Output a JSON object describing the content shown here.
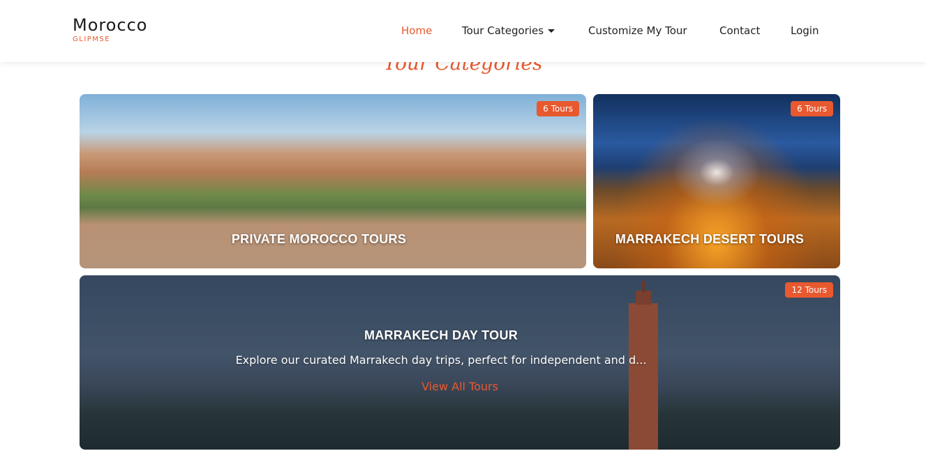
{
  "brand": {
    "name": "Morocco",
    "sub": "GLIPMSE"
  },
  "nav": {
    "items": [
      {
        "label": "Home",
        "active": true
      },
      {
        "label": "Tour Categories",
        "dropdown": true
      },
      {
        "label": "Customize My Tour"
      },
      {
        "label": "Contact"
      },
      {
        "label": "Login"
      }
    ]
  },
  "section": {
    "title": "Tour Categories"
  },
  "cards": [
    {
      "title": "PRIVATE MOROCCO TOURS",
      "badge": "6 Tours"
    },
    {
      "title": "MARRAKECH DESERT TOURS",
      "badge": "6 Tours"
    },
    {
      "title": "MARRAKECH DAY TOUR",
      "badge": "12 Tours",
      "description": "Explore our curated Marrakech day trips, perfect for independent and d...",
      "link": "View All Tours"
    }
  ],
  "colors": {
    "accent": "#e8592f",
    "text": "#222222"
  }
}
